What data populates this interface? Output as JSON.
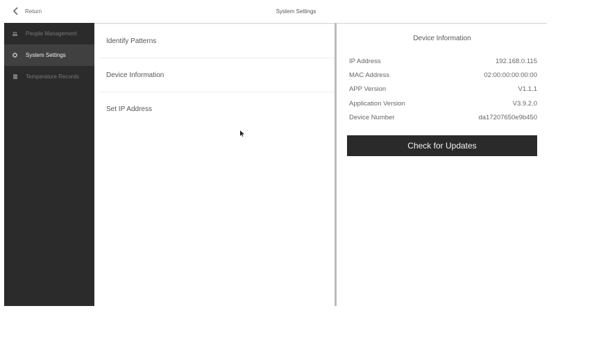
{
  "topbar": {
    "back_label": "Return",
    "title": "System Settings"
  },
  "sidebar": {
    "items": [
      {
        "label": "People Management",
        "icon": "people-icon",
        "active": false
      },
      {
        "label": "System Settings",
        "icon": "gear-icon",
        "active": true
      },
      {
        "label": "Temperature Records",
        "icon": "document-icon",
        "active": false
      }
    ]
  },
  "menu": {
    "items": [
      {
        "label": "Identify Patterns"
      },
      {
        "label": "Device Information"
      },
      {
        "label": "Set IP Address"
      }
    ]
  },
  "device_info": {
    "title": "Device Information",
    "rows": [
      {
        "label": "IP Address",
        "value": "192.168.0.115"
      },
      {
        "label": "MAC Address",
        "value": "02:00:00:00:00:00"
      },
      {
        "label": "APP Version",
        "value": "V1.1.1"
      },
      {
        "label": "Application Version",
        "value": "V3.9.2.0"
      },
      {
        "label": "Device Number",
        "value": "da17207650e9b450"
      }
    ],
    "check_updates_label": "Check for Updates"
  }
}
